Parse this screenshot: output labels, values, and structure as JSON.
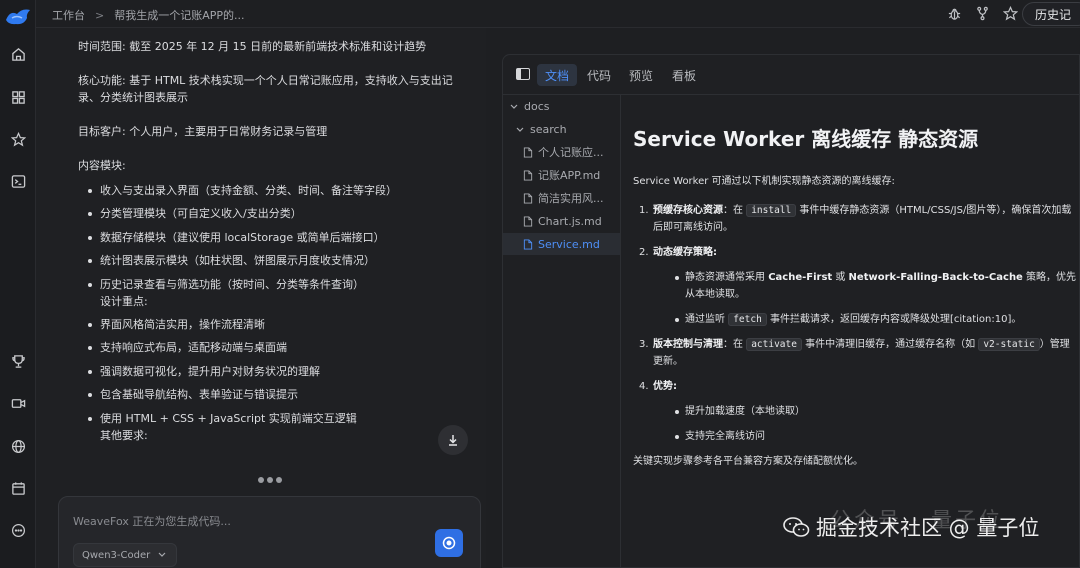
{
  "breadcrumb": {
    "home": "工作台",
    "separator": ">",
    "current": "帮我生成一个记账APP的..."
  },
  "header": {
    "history_label": "历史记"
  },
  "chat": {
    "paragraphs": [
      "时间范围: 截至 2025 年 12 月 15 日前的最新前端技术标准和设计趋势",
      "核心功能: 基于 HTML 技术栈实现一个个人日常记账应用，支持收入与支出记录、分类统计图表展示",
      "目标客户: 个人用户，主要用于日常财务记录与管理",
      "内容模块:"
    ],
    "items": [
      {
        "text": "收入与支出录入界面（支持金额、分类、时间、备注等字段）"
      },
      {
        "text": "分类管理模块（可自定义收入/支出分类）"
      },
      {
        "text": "数据存储模块（建议使用 localStorage 或简单后端接口）"
      },
      {
        "text": "统计图表展示模块（如柱状图、饼图展示月度收支情况）"
      },
      {
        "text": "历史记录查看与筛选功能（按时间、分类等条件查询）",
        "sub": "设计重点:"
      },
      {
        "text": "界面风格简洁实用，操作流程清晰"
      },
      {
        "text": "支持响应式布局，适配移动端与桌面端"
      },
      {
        "text": "强调数据可视化，提升用户对财务状况的理解"
      },
      {
        "text": "包含基础导航结构、表单验证与错误提示"
      },
      {
        "text": "使用 HTML + CSS + JavaScript 实现前端交互逻辑",
        "sub": "其他要求:"
      }
    ],
    "input_placeholder": "WeaveFox 正在为您生成代码...",
    "model": "Qwen3-Coder"
  },
  "doc_tabs": [
    "文档",
    "代码",
    "预览",
    "看板"
  ],
  "file_tree": {
    "root": "docs",
    "folder": "search",
    "files": [
      "个人记账应...",
      "记账APP.md",
      "简洁实用风...",
      "Chart.js.md",
      "Service.md"
    ]
  },
  "markdown": {
    "title": "Service Worker 离线缓存 静态资源",
    "intro": "Service Worker 可通过以下机制实现静态资源的离线缓存:",
    "s1": {
      "num": "1.",
      "bold": "预缓存核心资源",
      "pre": "：在 ",
      "code": "install",
      "post": " 事件中缓存静态资源（HTML/CSS/JS/图片等），确保首次加载后即可离线访问。"
    },
    "s2": {
      "num": "2.",
      "bold": "动态缓存策略",
      "b1_pre": "静态资源通常采用 ",
      "b1_bold1": "Cache-First",
      "b1_mid": " 或 ",
      "b1_bold2": "Network-Falling-Back-to-Cache",
      "b1_post": " 策略，优先从本地读取。",
      "b2_pre": "通过监听 ",
      "b2_code": "fetch",
      "b2_post": " 事件拦截请求，返回缓存内容或降级处理[citation:10]。"
    },
    "s3": {
      "num": "3.",
      "bold": "版本控制与清理",
      "pre": "：在 ",
      "code1": "activate",
      "mid": " 事件中清理旧缓存，通过缓存名称（如 ",
      "code2": "v2-static",
      "post": "）管理更新。"
    },
    "s4": {
      "num": "4.",
      "bold": "优势",
      "b1": "提升加载速度（本地读取）",
      "b2": "支持完全离线访问"
    },
    "outro": "关键实现步骤参考各平台兼容方案及存储配额优化。"
  },
  "watermark": {
    "text": "掘金技术社区 @ 量子位",
    "ghost": "公众号 · 量子位"
  },
  "colors": {
    "accent": "#4e8ff7",
    "send": "#2f6fe4",
    "bg": "#1e1f22"
  }
}
